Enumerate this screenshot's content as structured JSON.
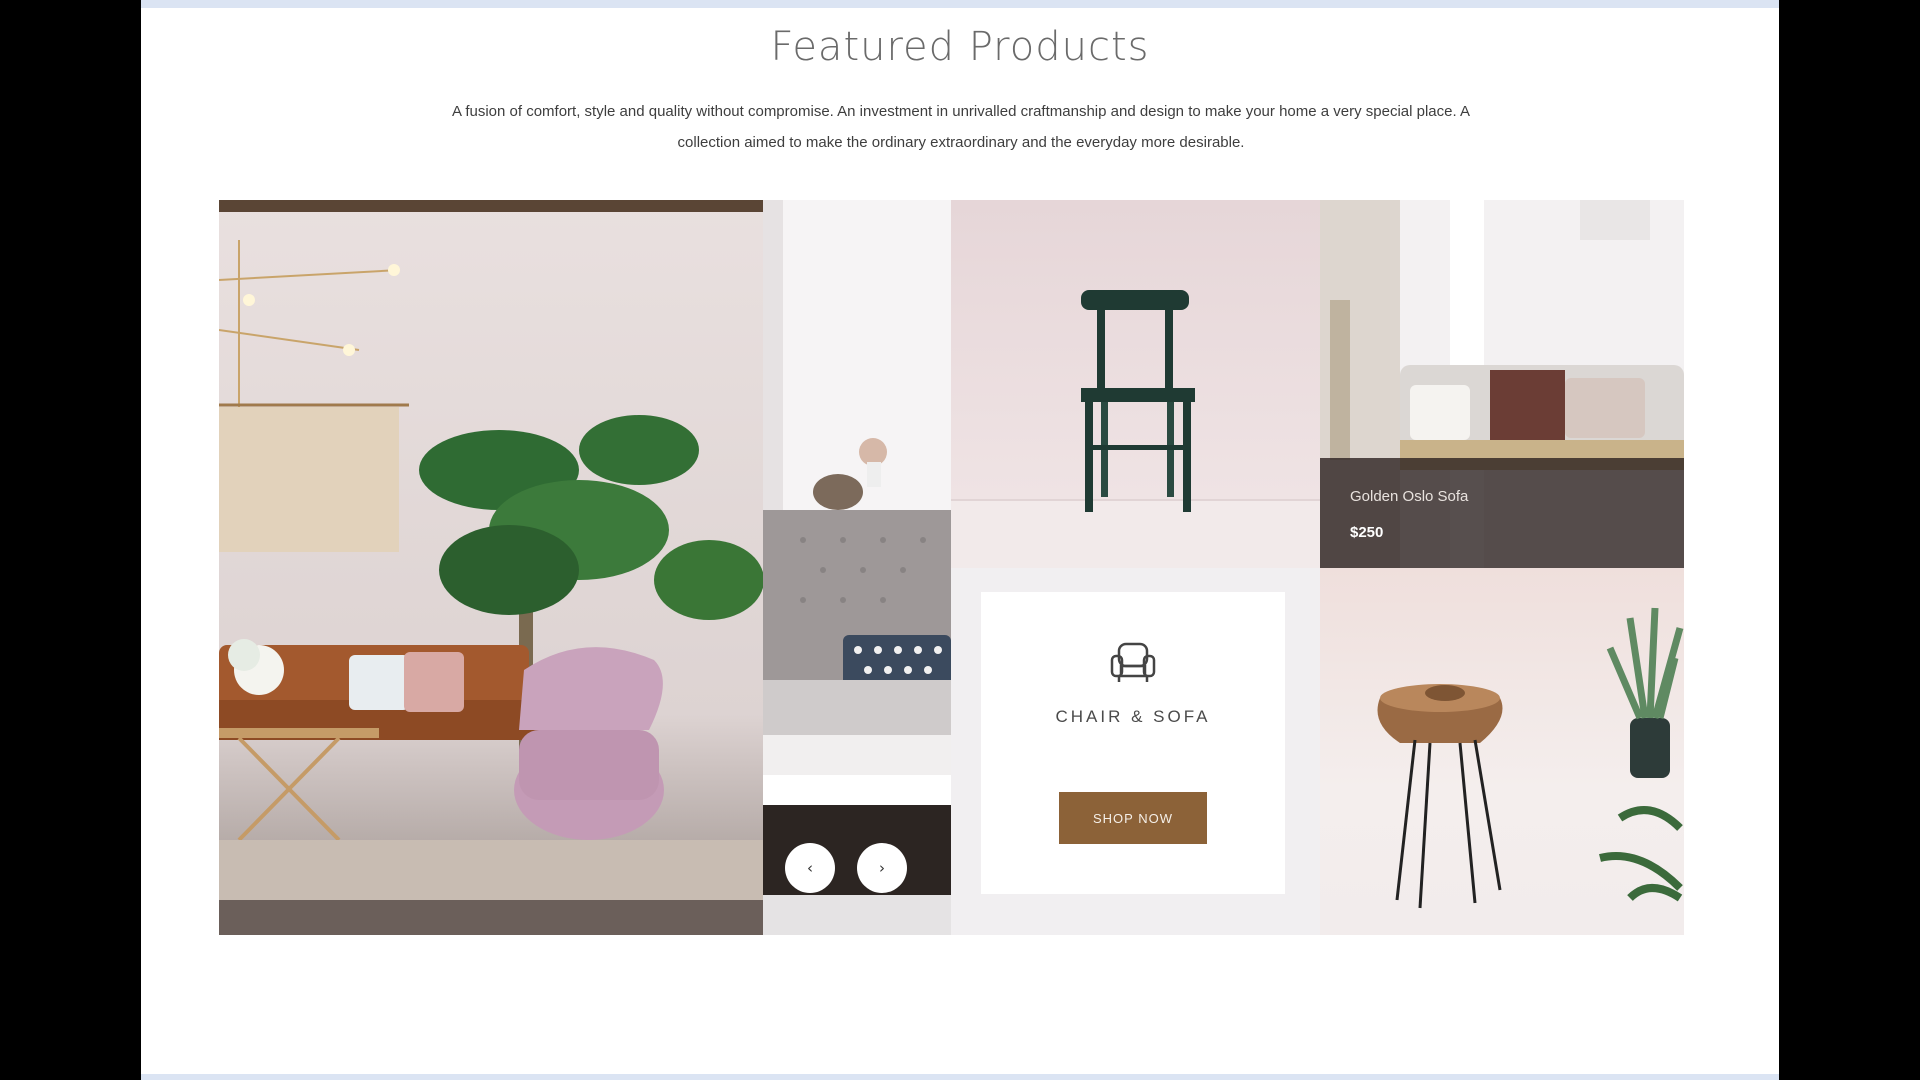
{
  "section": {
    "title": "Featured Products",
    "description": "A fusion of comfort, style and quality without compromise. An investment in unrivalled craftmanship and design to make your home a very special place. A collection aimed to make the ordinary extraordinary and the everyday more desirable."
  },
  "product_overlay": {
    "name": "Golden Oslo Sofa",
    "price": "$250"
  },
  "category_card": {
    "icon": "armchair-icon",
    "label": "CHAIR & SOFA",
    "button_label": "SHOP NOW"
  },
  "slider": {
    "prev_icon": "‹",
    "next_icon": "›"
  },
  "colors": {
    "button_brown": "#8c6238",
    "frame_border": "#dbe4f3"
  }
}
